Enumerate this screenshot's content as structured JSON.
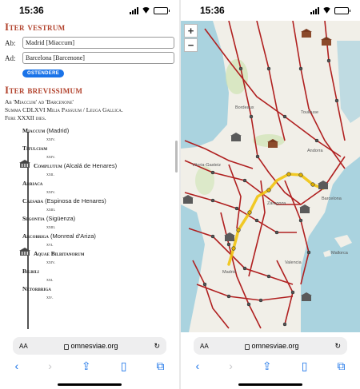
{
  "status": {
    "time": "15:36"
  },
  "left": {
    "iter_vestrum_title": "Iter vestrum",
    "from_label": "Ab:",
    "from_value": "Madrid [Miaccum]",
    "to_label": "Ad:",
    "to_value": "Barcelona [Barcenone]",
    "ostendere_label": "OSTENDERE",
    "iter_brevissimum_title": "Iter brevissimum",
    "summary_lines": [
      "Ab 'Miaccum' ad 'Barcenone'",
      "Summa CDLXVI Milia Passuum / Leuga Gallica.",
      "Fere XXXII dies."
    ],
    "stops": [
      {
        "name": "Miaccum",
        "modern": " (Madrid)",
        "dist": "xxiv."
      },
      {
        "name": "Titulciam",
        "modern": "",
        "dist": "xxiv."
      },
      {
        "name": "Complutum",
        "modern": " (Alcalá de Henares)",
        "dist": "xxii."
      },
      {
        "name": "Arriaca",
        "modern": "",
        "dist": "xxiv."
      },
      {
        "name": "Caesada",
        "modern": " (Espinosa de Henares)",
        "dist": "xxiii."
      },
      {
        "name": "Segontia",
        "modern": " (Sigüenza)",
        "dist": "xxiii."
      },
      {
        "name": "Arcobriga",
        "modern": " (Monreal d'Ariza)",
        "dist": "xvi."
      },
      {
        "name": "Aquae Bilbitanorum",
        "modern": "",
        "dist": "xxiv."
      },
      {
        "name": "Bilbili",
        "modern": "",
        "dist": "xxi."
      },
      {
        "name": "Netorbriga",
        "modern": "",
        "dist": "xiv."
      }
    ]
  },
  "browser": {
    "aa": "AA",
    "url": "omnesviae.org"
  },
  "map": {
    "zoom_in": "+",
    "zoom_out": "−",
    "labels": [
      "Bordeaux",
      "Toulouse",
      "Andorra",
      "Barcelona",
      "Valencia",
      "Mallorca",
      "Vitoria-Gasteiz",
      "Zaragoza",
      "Madrid"
    ]
  }
}
